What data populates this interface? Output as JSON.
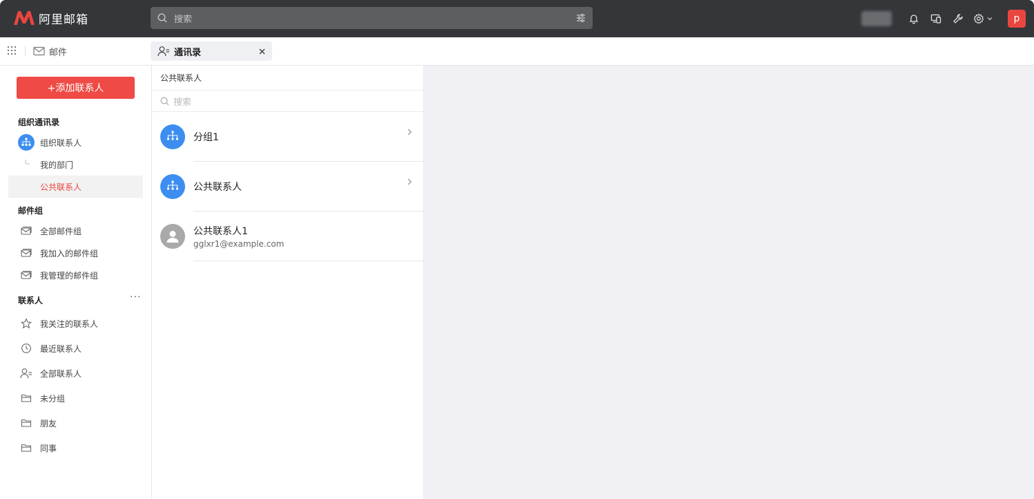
{
  "app": {
    "logo_text": "阿里邮箱",
    "brand_color": "#e9463f"
  },
  "search": {
    "placeholder": "搜索"
  },
  "topbar": {
    "user_initial": "p",
    "icons": [
      "bell-icon",
      "devices-icon",
      "wrench-icon",
      "gear-icon"
    ]
  },
  "nav": {
    "mail_label": "邮件",
    "tab_label": "通讯录"
  },
  "sidebar": {
    "add_button": "+添加联系人",
    "org_section": "组织通讯录",
    "org_contacts": "组织联系人",
    "my_dept": "我的部门",
    "public_contacts": "公共联系人",
    "group_section": "邮件组",
    "all_groups": "全部邮件组",
    "joined_groups": "我加入的邮件组",
    "managed_groups": "我管理的邮件组",
    "contacts_section": "联系人",
    "more": "···",
    "starred": "我关注的联系人",
    "recent": "最近联系人",
    "all_contacts": "全部联系人",
    "ungrouped": "未分组",
    "friends": "朋友",
    "colleagues": "同事"
  },
  "list": {
    "title": "公共联系人",
    "search_placeholder": "搜索",
    "items": [
      {
        "name": "分组1",
        "type": "group"
      },
      {
        "name": "公共联系人",
        "type": "group"
      },
      {
        "name": "公共联系人1",
        "email": "gglxr1@example.com",
        "type": "person"
      }
    ]
  }
}
